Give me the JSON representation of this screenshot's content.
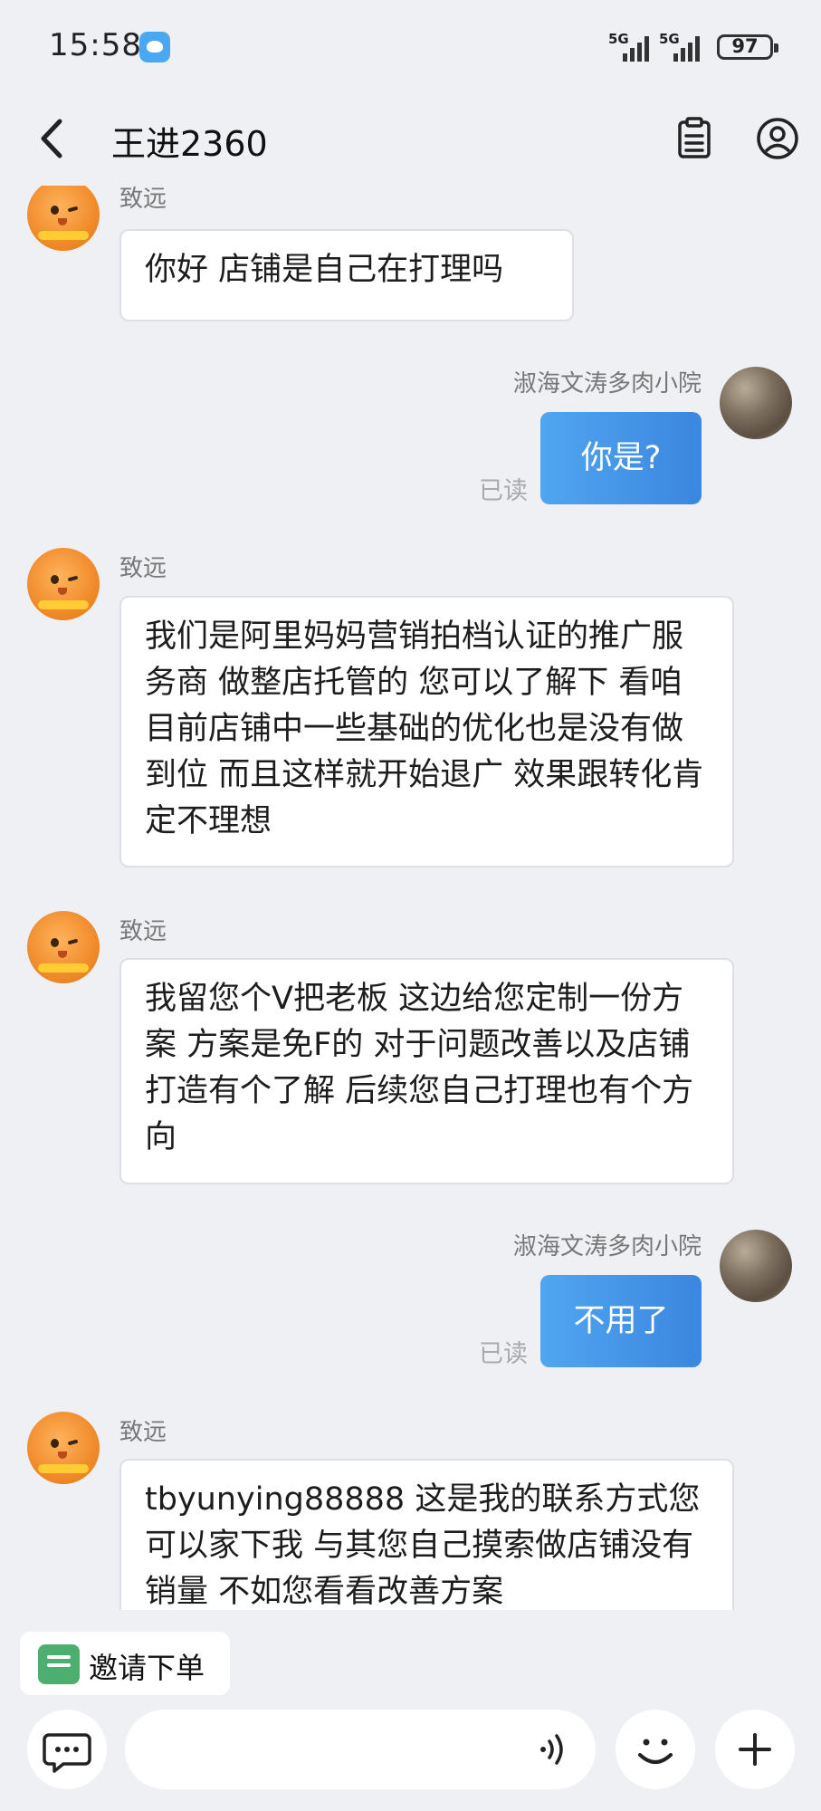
{
  "status_bar": {
    "time": "15:58",
    "network1": "5G",
    "network2": "5G",
    "battery": "97"
  },
  "header": {
    "title": "王进2360"
  },
  "messages": [
    {
      "side": "left",
      "sender": "致远",
      "text": "你好 店铺是自己在打理吗"
    },
    {
      "side": "right",
      "sender": "淑海文涛多肉小院",
      "text": "你是?",
      "status": "已读"
    },
    {
      "side": "left",
      "sender": "致远",
      "text": "我们是阿里妈妈营销拍档认证的推广服务商 做整店托管的  您可以了解下  看咱目前店铺中一些基础的优化也是没有做到位 而且这样就开始退广 效果跟转化肯定不理想"
    },
    {
      "side": "left",
      "sender": "致远",
      "text": "我留您个V把老板  这边给您定制一份方案 方案是免F的  对于问题改善以及店铺打造有个了解  后续您自己打理也有个方向"
    },
    {
      "side": "right",
      "sender": "淑海文涛多肉小院",
      "text": "不用了",
      "status": "已读"
    },
    {
      "side": "left",
      "sender": "致远",
      "text": "tbyunying88888   这是我的联系方式您可以家下我 与其您自己摸索做店铺没有销量 不如您看看改善方案"
    }
  ],
  "bottom": {
    "invite_label": "邀请下单",
    "input_placeholder": ""
  },
  "colors": {
    "background": "#eef0f4",
    "bubble_right": "#4a9cec",
    "bubble_left": "#ffffff"
  }
}
